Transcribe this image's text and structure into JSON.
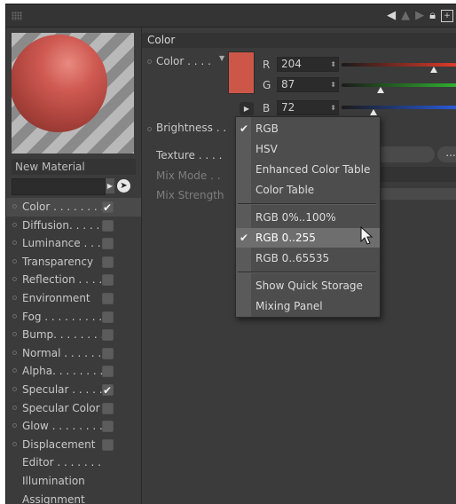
{
  "colors": {
    "material_color": "#cc5748",
    "red_slider": "#e03a2a",
    "green_slider": "#2fb02f",
    "blue_slider": "#2a5ad8"
  },
  "left": {
    "material_name": "New Material",
    "channels": [
      {
        "label": "Color . . . . . . . .",
        "checked": true,
        "selected": true
      },
      {
        "label": "Diffusion. . . . . .",
        "checked": false
      },
      {
        "label": "Luminance . . . .",
        "checked": false
      },
      {
        "label": "Transparency",
        "checked": false
      },
      {
        "label": "Reflection . . . .",
        "checked": false
      },
      {
        "label": "Environment",
        "checked": false
      },
      {
        "label": "Fog . . . . . . . . .",
        "checked": false
      },
      {
        "label": "Bump. . . . . . . .",
        "checked": false
      },
      {
        "label": "Normal . . . . . .",
        "checked": false
      },
      {
        "label": "Alpha. . . . . . . .",
        "checked": false
      },
      {
        "label": "Specular . . . . .",
        "checked": true
      },
      {
        "label": "Specular Color",
        "checked": false
      },
      {
        "label": "Glow . . . . . . . .",
        "checked": false
      },
      {
        "label": "Displacement",
        "checked": false
      },
      {
        "label": "Editor . . . . . . .",
        "checked": null
      },
      {
        "label": "Illumination",
        "checked": null
      },
      {
        "label": "Assignment",
        "checked": null
      }
    ]
  },
  "right": {
    "section_title": "Color",
    "color_label": "Color . . . .",
    "channels": {
      "r_label": "R",
      "r_value": "204",
      "r_fraction": 0.8,
      "g_label": "G",
      "g_value": "87",
      "g_fraction": 0.34,
      "b_label": "B",
      "b_value": "72",
      "b_fraction": 0.28
    },
    "brightness_label": "Brightness . .",
    "texture_label": "Texture . . . .",
    "mix_mode_label": "Mix Mode . .",
    "mix_strength_label": "Mix Strength",
    "texture_button": "..."
  },
  "menu": {
    "group1": [
      {
        "label": "RGB",
        "checked": true
      },
      {
        "label": "HSV",
        "checked": false
      },
      {
        "label": "Enhanced Color Table",
        "checked": false
      },
      {
        "label": "Color Table",
        "checked": false
      }
    ],
    "group2": [
      {
        "label": "RGB 0%..100%",
        "checked": false
      },
      {
        "label": "RGB 0..255",
        "checked": true,
        "highlighted": true
      },
      {
        "label": "RGB 0..65535",
        "checked": false
      }
    ],
    "group3": [
      {
        "label": "Show Quick Storage",
        "checked": false
      },
      {
        "label": "Mixing Panel",
        "checked": false
      }
    ]
  }
}
